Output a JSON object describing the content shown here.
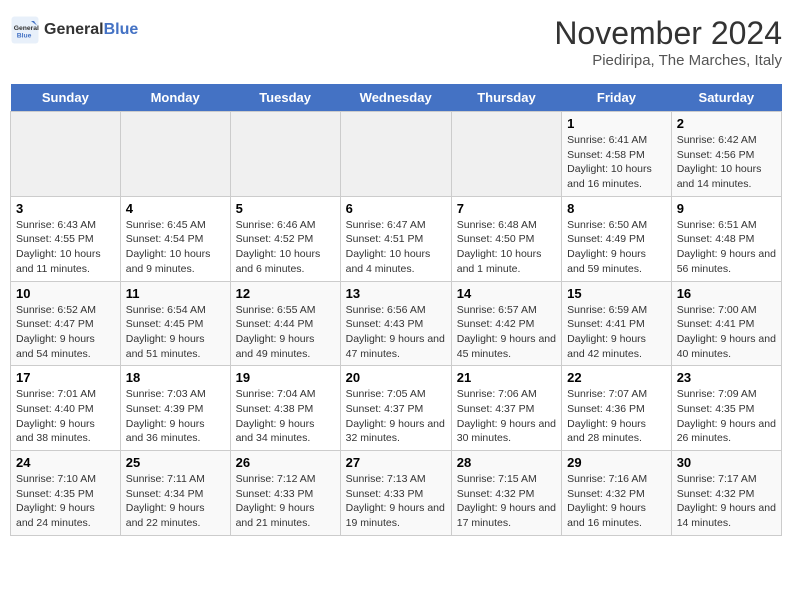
{
  "logo": {
    "line1": "General",
    "line2": "Blue"
  },
  "title": "November 2024",
  "subtitle": "Piediripa, The Marches, Italy",
  "headers": [
    "Sunday",
    "Monday",
    "Tuesday",
    "Wednesday",
    "Thursday",
    "Friday",
    "Saturday"
  ],
  "weeks": [
    [
      {
        "day": "",
        "info": ""
      },
      {
        "day": "",
        "info": ""
      },
      {
        "day": "",
        "info": ""
      },
      {
        "day": "",
        "info": ""
      },
      {
        "day": "",
        "info": ""
      },
      {
        "day": "1",
        "info": "Sunrise: 6:41 AM\nSunset: 4:58 PM\nDaylight: 10 hours and 16 minutes."
      },
      {
        "day": "2",
        "info": "Sunrise: 6:42 AM\nSunset: 4:56 PM\nDaylight: 10 hours and 14 minutes."
      }
    ],
    [
      {
        "day": "3",
        "info": "Sunrise: 6:43 AM\nSunset: 4:55 PM\nDaylight: 10 hours and 11 minutes."
      },
      {
        "day": "4",
        "info": "Sunrise: 6:45 AM\nSunset: 4:54 PM\nDaylight: 10 hours and 9 minutes."
      },
      {
        "day": "5",
        "info": "Sunrise: 6:46 AM\nSunset: 4:52 PM\nDaylight: 10 hours and 6 minutes."
      },
      {
        "day": "6",
        "info": "Sunrise: 6:47 AM\nSunset: 4:51 PM\nDaylight: 10 hours and 4 minutes."
      },
      {
        "day": "7",
        "info": "Sunrise: 6:48 AM\nSunset: 4:50 PM\nDaylight: 10 hours and 1 minute."
      },
      {
        "day": "8",
        "info": "Sunrise: 6:50 AM\nSunset: 4:49 PM\nDaylight: 9 hours and 59 minutes."
      },
      {
        "day": "9",
        "info": "Sunrise: 6:51 AM\nSunset: 4:48 PM\nDaylight: 9 hours and 56 minutes."
      }
    ],
    [
      {
        "day": "10",
        "info": "Sunrise: 6:52 AM\nSunset: 4:47 PM\nDaylight: 9 hours and 54 minutes."
      },
      {
        "day": "11",
        "info": "Sunrise: 6:54 AM\nSunset: 4:45 PM\nDaylight: 9 hours and 51 minutes."
      },
      {
        "day": "12",
        "info": "Sunrise: 6:55 AM\nSunset: 4:44 PM\nDaylight: 9 hours and 49 minutes."
      },
      {
        "day": "13",
        "info": "Sunrise: 6:56 AM\nSunset: 4:43 PM\nDaylight: 9 hours and 47 minutes."
      },
      {
        "day": "14",
        "info": "Sunrise: 6:57 AM\nSunset: 4:42 PM\nDaylight: 9 hours and 45 minutes."
      },
      {
        "day": "15",
        "info": "Sunrise: 6:59 AM\nSunset: 4:41 PM\nDaylight: 9 hours and 42 minutes."
      },
      {
        "day": "16",
        "info": "Sunrise: 7:00 AM\nSunset: 4:41 PM\nDaylight: 9 hours and 40 minutes."
      }
    ],
    [
      {
        "day": "17",
        "info": "Sunrise: 7:01 AM\nSunset: 4:40 PM\nDaylight: 9 hours and 38 minutes."
      },
      {
        "day": "18",
        "info": "Sunrise: 7:03 AM\nSunset: 4:39 PM\nDaylight: 9 hours and 36 minutes."
      },
      {
        "day": "19",
        "info": "Sunrise: 7:04 AM\nSunset: 4:38 PM\nDaylight: 9 hours and 34 minutes."
      },
      {
        "day": "20",
        "info": "Sunrise: 7:05 AM\nSunset: 4:37 PM\nDaylight: 9 hours and 32 minutes."
      },
      {
        "day": "21",
        "info": "Sunrise: 7:06 AM\nSunset: 4:37 PM\nDaylight: 9 hours and 30 minutes."
      },
      {
        "day": "22",
        "info": "Sunrise: 7:07 AM\nSunset: 4:36 PM\nDaylight: 9 hours and 28 minutes."
      },
      {
        "day": "23",
        "info": "Sunrise: 7:09 AM\nSunset: 4:35 PM\nDaylight: 9 hours and 26 minutes."
      }
    ],
    [
      {
        "day": "24",
        "info": "Sunrise: 7:10 AM\nSunset: 4:35 PM\nDaylight: 9 hours and 24 minutes."
      },
      {
        "day": "25",
        "info": "Sunrise: 7:11 AM\nSunset: 4:34 PM\nDaylight: 9 hours and 22 minutes."
      },
      {
        "day": "26",
        "info": "Sunrise: 7:12 AM\nSunset: 4:33 PM\nDaylight: 9 hours and 21 minutes."
      },
      {
        "day": "27",
        "info": "Sunrise: 7:13 AM\nSunset: 4:33 PM\nDaylight: 9 hours and 19 minutes."
      },
      {
        "day": "28",
        "info": "Sunrise: 7:15 AM\nSunset: 4:32 PM\nDaylight: 9 hours and 17 minutes."
      },
      {
        "day": "29",
        "info": "Sunrise: 7:16 AM\nSunset: 4:32 PM\nDaylight: 9 hours and 16 minutes."
      },
      {
        "day": "30",
        "info": "Sunrise: 7:17 AM\nSunset: 4:32 PM\nDaylight: 9 hours and 14 minutes."
      }
    ]
  ]
}
